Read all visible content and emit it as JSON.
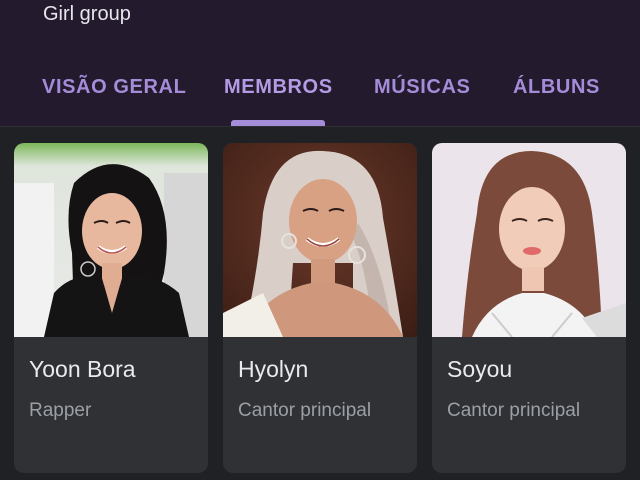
{
  "header": {
    "subtitle": "Girl group"
  },
  "tabs": [
    {
      "label": "VISÃO GERAL",
      "active": false
    },
    {
      "label": "MEMBROS",
      "active": true
    },
    {
      "label": "MÚSICAS",
      "active": false
    },
    {
      "label": "ÁLBUNS",
      "active": false
    }
  ],
  "colors": {
    "header_bg": "#231a2e",
    "accent": "#a58cd8",
    "card_bg": "#303134",
    "page_bg": "#202124"
  },
  "members": [
    {
      "name": "Yoon Bora",
      "role": "Rapper"
    },
    {
      "name": "Hyolyn",
      "role": "Cantor principal"
    },
    {
      "name": "Soyou",
      "role": "Cantor principal"
    }
  ]
}
